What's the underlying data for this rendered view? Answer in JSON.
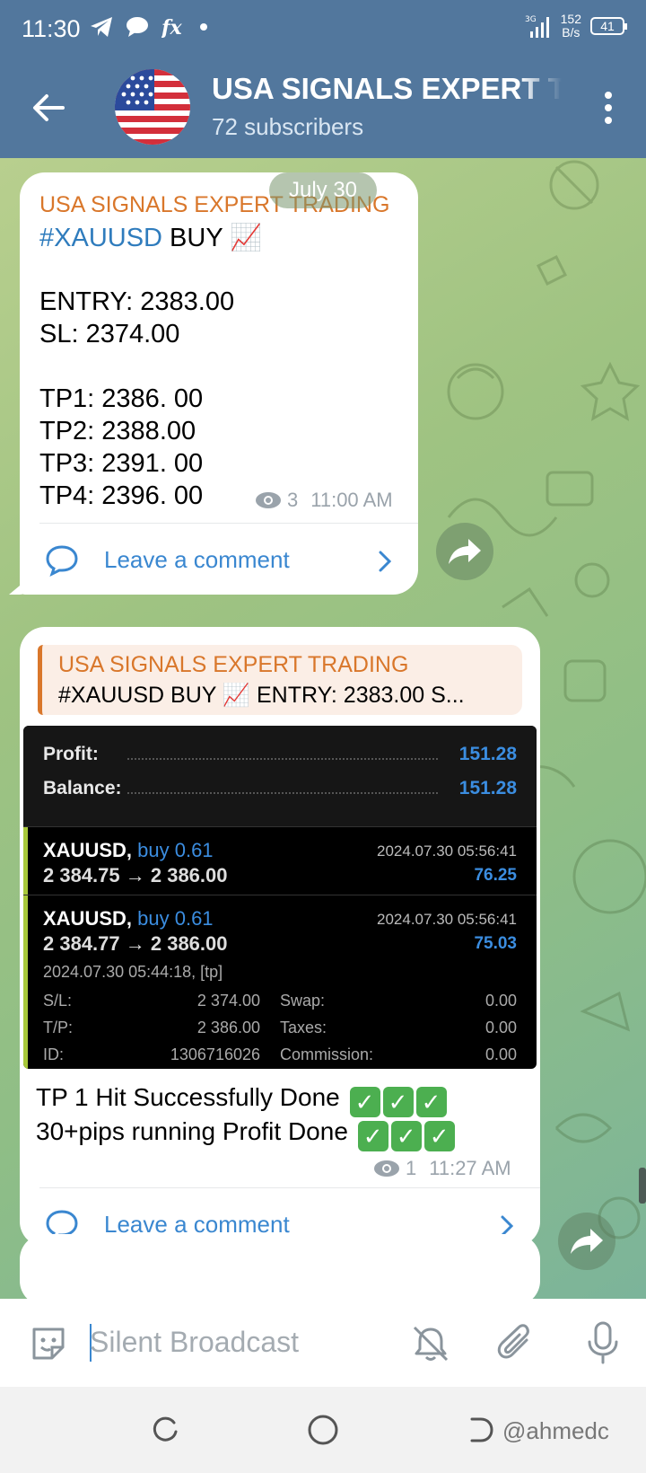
{
  "status_bar": {
    "time": "11:30",
    "network": "3G",
    "speed_value": "152",
    "speed_unit": "B/s",
    "battery": "41"
  },
  "header": {
    "title": "USA SIGNALS EXPERT TRADING",
    "subscribers": "72 subscribers"
  },
  "chat": {
    "date_chip": "July 30",
    "post1": {
      "sender": "USA SIGNALS EXPERT TRADING",
      "hashtag": "#XAUUSD",
      "action": " BUY 📈",
      "entry": "ENTRY:  2383.00",
      "sl": "SL: 2374.00",
      "tp1": "TP1: 2386. 00",
      "tp2": "TP2: 2388.00",
      "tp3": "TP3: 2391. 00",
      "tp4": "TP4: 2396. 00",
      "views": "3",
      "time": "11:00 AM",
      "comment_label": "Leave a comment"
    },
    "post2": {
      "reply_sender": "USA SIGNALS EXPERT TRADING",
      "reply_text": "#XAUUSD BUY 📈  ENTRY:  2383.00 S...",
      "screenshot": {
        "profit_label": "Profit:",
        "profit_value": "151.28",
        "balance_label": "Balance:",
        "balance_value": "151.28",
        "positions": [
          {
            "symbol": "XAUUSD,",
            "side": "buy 0.61",
            "prices": "2 384.75 → 2 386.00",
            "timestamp": "2024.07.30 05:56:41",
            "profit": "76.25"
          },
          {
            "symbol": "XAUUSD,",
            "side": "buy 0.61",
            "prices": "2 384.77 → 2 386.00",
            "timestamp": "2024.07.30 05:56:41",
            "profit": "75.03"
          }
        ],
        "open_time": "2024.07.30 05:44:18, [tp]",
        "sl_label": "S/L:",
        "sl_value": "2 374.00",
        "tp_label": "T/P:",
        "tp_value": "2 386.00",
        "id_label": "ID:",
        "id_value": "1306716026",
        "swap_label": "Swap:",
        "swap_value": "0.00",
        "taxes_label": "Taxes:",
        "taxes_value": "0.00",
        "commission_label": "Commission:",
        "commission_value": "0.00"
      },
      "line1": "TP 1 Hit Successfully Done",
      "line2": "30+pips running Profit Done",
      "views": "1",
      "time": "11:27 AM",
      "comment_label": "Leave a comment"
    }
  },
  "composer": {
    "placeholder": "Silent Broadcast"
  },
  "watermark": "@ahmedc"
}
